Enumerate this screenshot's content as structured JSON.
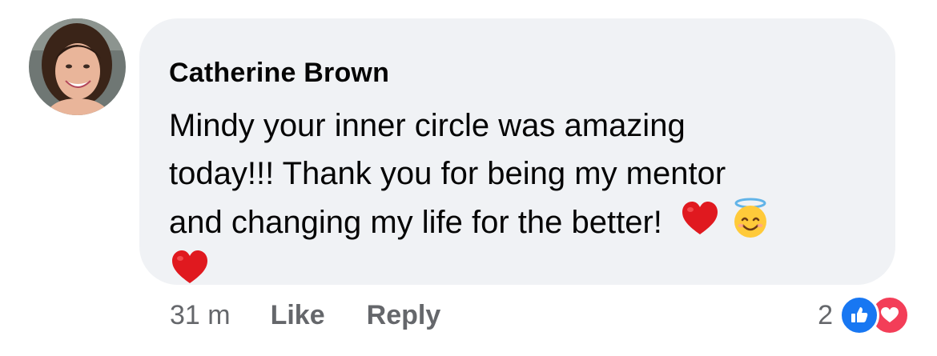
{
  "comment": {
    "author": "Catherine Brown",
    "text_line1": "Mindy your inner circle was amazing",
    "text_line2": "today!!! Thank you for being my mentor",
    "text_line3": "and changing my life for the better!",
    "emojis": [
      "red-heart",
      "smiling-face-with-halo",
      "red-heart"
    ]
  },
  "footer": {
    "timestamp": "31 m",
    "like_label": "Like",
    "reply_label": "Reply"
  },
  "reactions": {
    "count": "2",
    "types": [
      "like-icon",
      "love-icon"
    ]
  },
  "colors": {
    "bubble": "#f0f2f5",
    "text": "#050505",
    "meta": "#65676b",
    "like_blue": "#1877f2",
    "love_red": "#f33e58"
  }
}
